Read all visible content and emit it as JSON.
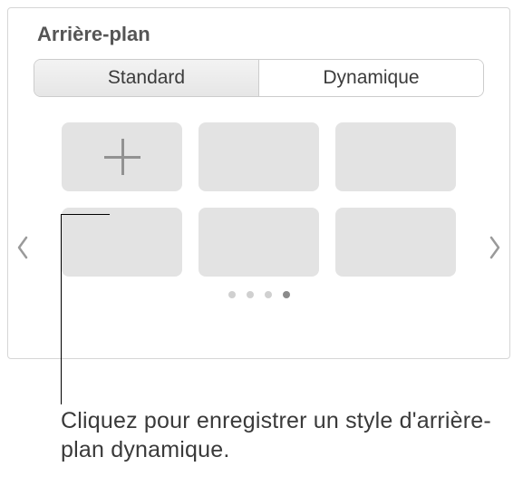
{
  "section": {
    "title": "Arrière-plan"
  },
  "tabs": {
    "standard": "Standard",
    "dynamic": "Dynamique",
    "selected": "dynamic"
  },
  "nav": {
    "prev_icon": "chevron-left",
    "next_icon": "chevron-right"
  },
  "pager": {
    "count": 4,
    "active": 3
  },
  "caption": "Cliquez pour enregistrer un style d'arrière-plan dynamique."
}
